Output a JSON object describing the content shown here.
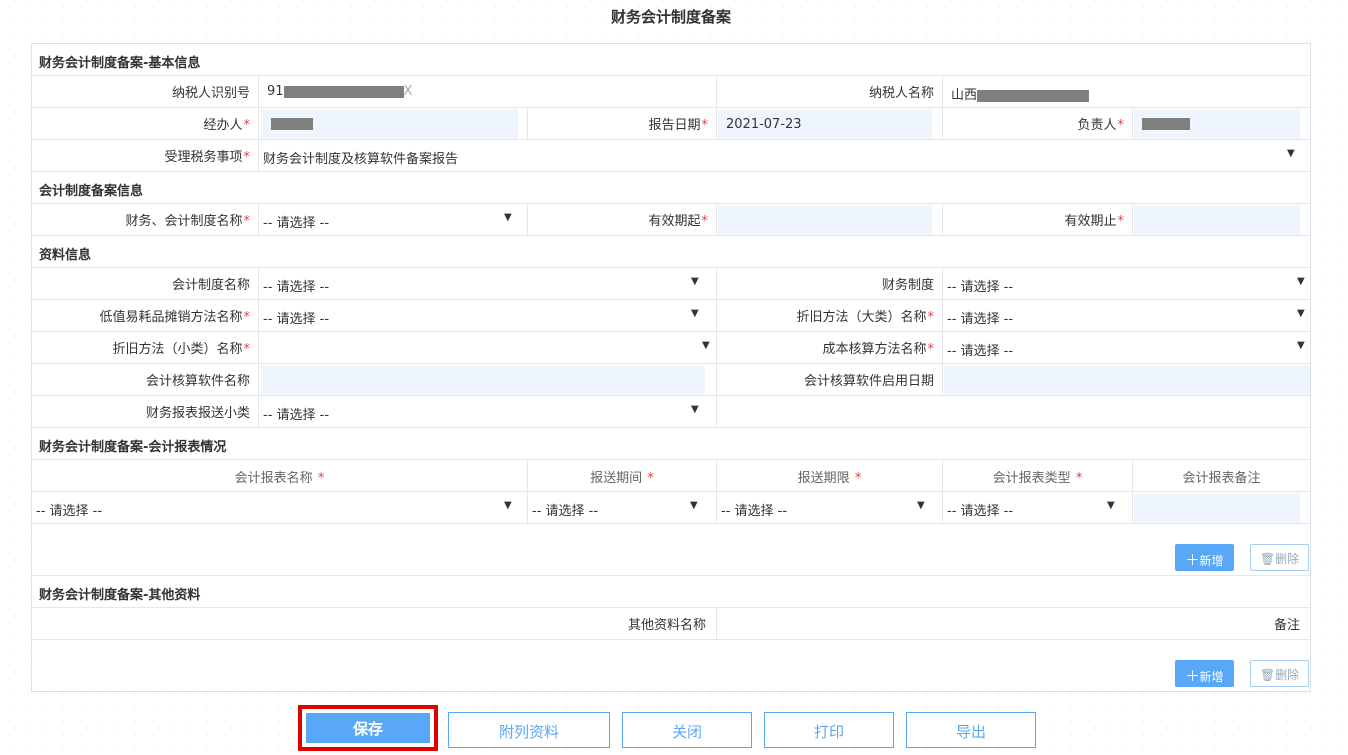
{
  "page_title": "财务会计制度备案",
  "section_basic": "财务会计制度备案-基本信息",
  "taxpayer_id_label": "纳税人识别号",
  "taxpayer_id_prefix": "91",
  "taxpayer_id_suffix": "X",
  "taxpayer_name_label": "纳税人名称",
  "taxpayer_name_prefix": "山西",
  "handler_label": "经办人",
  "report_date_label": "报告日期",
  "report_date_value": "2021-07-23",
  "principal_label": "负责人",
  "tax_matter_label": "受理税务事项",
  "tax_matter_value": "财务会计制度及核算软件备案报告",
  "section_acct": "会计制度备案信息",
  "acct_system_name_label": "财务、会计制度名称",
  "valid_from_label": "有效期起",
  "valid_to_label": "有效期止",
  "section_material": "资料信息",
  "accounting_system_label": "会计制度名称",
  "finance_system_label": "财务制度",
  "low_value_label": "低值易耗品摊销方法名称",
  "depr_major_label": "折旧方法（大类）名称",
  "depr_minor_label": "折旧方法（小类）名称",
  "cost_method_label": "成本核算方法名称",
  "software_name_label": "会计核算软件名称",
  "software_date_label": "会计核算软件启用日期",
  "report_subtype_label": "财务报表报送小类",
  "select_placeholder": "-- 请选择 --",
  "required_mark": "*",
  "section_reports": "财务会计制度备案-会计报表情况",
  "report_columns": [
    "会计报表名称",
    "报送期间",
    "报送期限",
    "会计报表类型",
    "会计报表备注"
  ],
  "section_other": "财务会计制度备案-其他资料",
  "other_columns": [
    "其他资料名称",
    "备注"
  ],
  "add_label": "新增",
  "delete_label": "删除",
  "buttons": {
    "save": "保存",
    "attachments": "附列资料",
    "close": "关闭",
    "print": "打印",
    "export": "导出"
  },
  "colors": {
    "primary": "#59a8f7",
    "highlight": "#e00000",
    "required": "#e53e3e",
    "input_bg": "#eef5fc"
  },
  "icons": {
    "add": "plus-icon",
    "delete": "trash-icon",
    "dropdown": "caret-down-icon"
  }
}
